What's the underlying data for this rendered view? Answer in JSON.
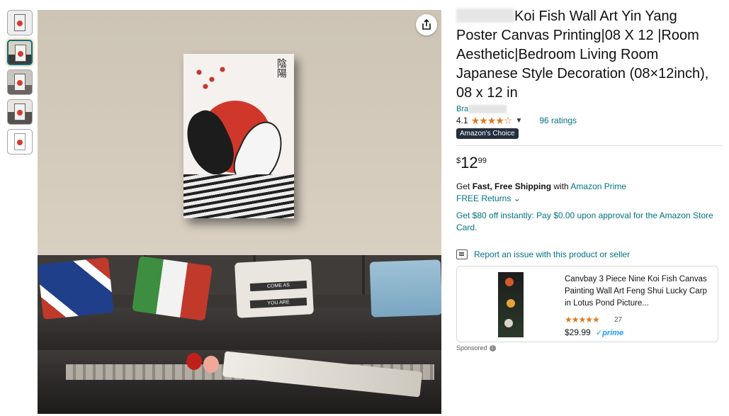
{
  "gallery": {
    "thumbnails": [
      "thumb-1",
      "thumb-2",
      "thumb-3",
      "thumb-4",
      "thumb-5"
    ],
    "poster_kanji": "陰陽",
    "pillow_text_1": "COME AS",
    "pillow_text_2": "YOU ARE",
    "share_icon": "share-icon"
  },
  "product": {
    "title": "Koi Fish Wall Art Yin Yang Poster Canvas Printing|08 X 12 |Room Aesthetic|Bedroom Living Room Japanese Style Decoration (08×12inch), 08 x 12 in",
    "brand_prefix": "Bra",
    "rating_value": "4.1",
    "rating_stars": "★★★★☆",
    "ratings_count": "96 ratings",
    "badge": "Amazon's Choice",
    "price_symbol": "$",
    "price_whole": "12",
    "price_fraction": "99"
  },
  "shipping": {
    "get": "Get ",
    "fast_free": "Fast, Free Shipping",
    "with": " with ",
    "prime_link": "Amazon Prime",
    "returns": "FREE Returns ⌄",
    "card_offer": "Get $80 off instantly: Pay $0.00 upon approval for the Amazon Store Card."
  },
  "report": {
    "label": "Report an issue with this product or seller"
  },
  "sponsored_product": {
    "title": "Canvbay 3 Piece Nine Koi Fish Canvas Painting Wall Art Feng Shui Lucky Carp in Lotus Pond Picture...",
    "stars": "★★★★★",
    "reviews": "27",
    "price": "$29.99",
    "prime": "✓prime",
    "sponsored_label": "Sponsored"
  },
  "colors": {
    "link": "#007185",
    "star": "#de7921",
    "badge_bg": "#232f3e"
  }
}
